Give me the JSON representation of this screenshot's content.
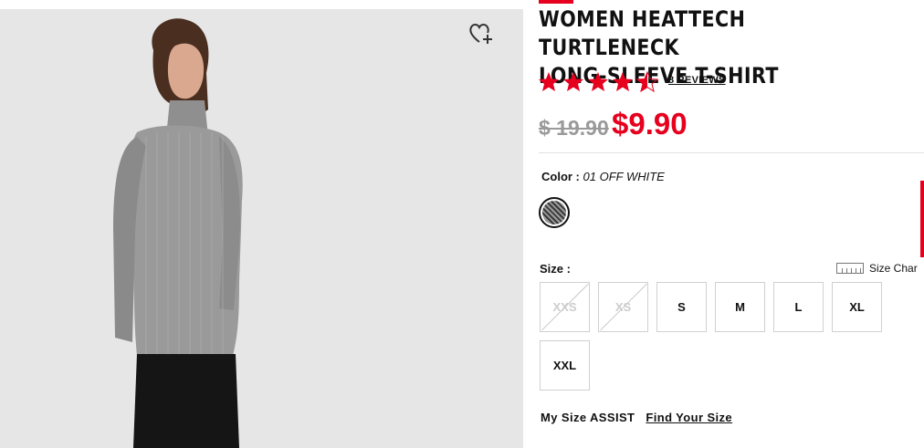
{
  "product": {
    "title_line1": "WOMEN HEATTECH TURTLENECK",
    "title_line2": "LONG-SLEEVE T-SHIRT",
    "rating": 4.5,
    "reviews_label": "8 REVIEWS",
    "original_price": "$ 19.90",
    "sale_price": "$9.90"
  },
  "color": {
    "label": "Color :",
    "value": "01 OFF WHITE"
  },
  "size": {
    "label": "Size :",
    "chart_label": "Size Char",
    "options": [
      {
        "label": "XXS",
        "available": false
      },
      {
        "label": "XS",
        "available": false
      },
      {
        "label": "S",
        "available": true
      },
      {
        "label": "M",
        "available": true
      },
      {
        "label": "L",
        "available": true
      },
      {
        "label": "XL",
        "available": true
      },
      {
        "label": "XXL",
        "available": true
      }
    ]
  },
  "assist": {
    "label": "My Size ASSIST",
    "link": "Find Your Size"
  },
  "colors": {
    "accent": "#e6001e",
    "photo_bg": "#e6e6e6",
    "muted": "#9a9a9a"
  }
}
